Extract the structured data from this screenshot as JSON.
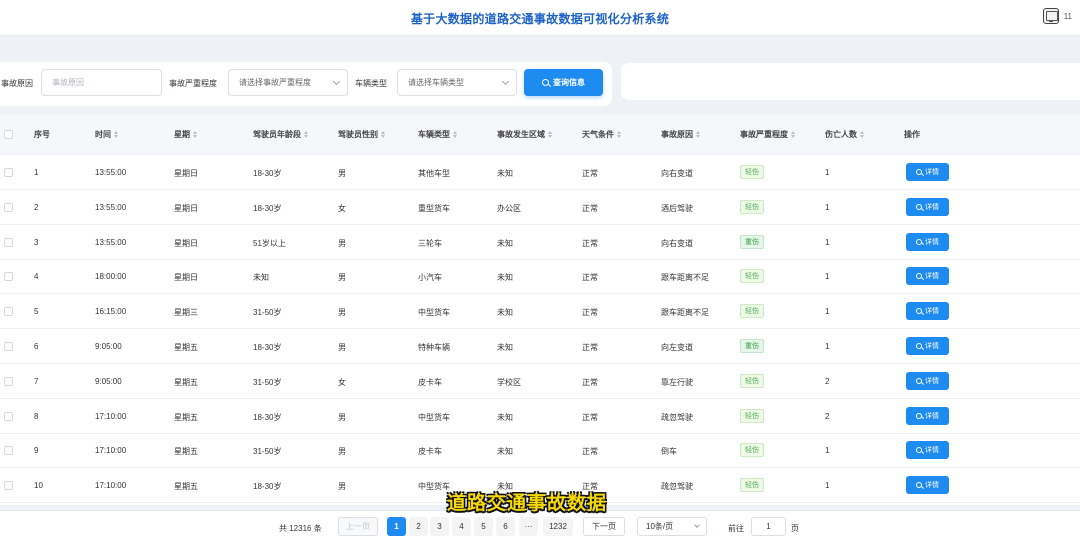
{
  "header": {
    "title": "基于大数据的道路交通事故数据可视化分析系统",
    "user": "11"
  },
  "filters": {
    "cause_label": "事故原因",
    "cause_placeholder": "事故原因",
    "severity_label": "事故严重程度",
    "severity_placeholder": "请选择事故严重程度",
    "vehicle_label": "车辆类型",
    "vehicle_placeholder": "请选择车辆类型",
    "search_label": "查询信息"
  },
  "table": {
    "headers": [
      "序号",
      "时间",
      "星期",
      "驾驶员年龄段",
      "驾驶员性别",
      "车辆类型",
      "事故发生区域",
      "天气条件",
      "事故原因",
      "事故严重程度",
      "伤亡人数",
      "操作"
    ],
    "detail_label": "详情",
    "rows": [
      [
        "1",
        "13:55:00",
        "星期日",
        "18-30岁",
        "男",
        "其他车型",
        "未知",
        "正常",
        "向右变道",
        "轻伤",
        "1"
      ],
      [
        "2",
        "13:55:00",
        "星期日",
        "18-30岁",
        "女",
        "重型货车",
        "办公区",
        "正常",
        "酒后驾驶",
        "轻伤",
        "1"
      ],
      [
        "3",
        "13:55:00",
        "星期日",
        "51岁以上",
        "男",
        "三轮车",
        "未知",
        "正常",
        "向右变道",
        "重伤",
        "1"
      ],
      [
        "4",
        "18:00:00",
        "星期日",
        "未知",
        "男",
        "小汽车",
        "未知",
        "正常",
        "跟车距离不足",
        "轻伤",
        "1"
      ],
      [
        "5",
        "16:15:00",
        "星期三",
        "31-50岁",
        "男",
        "中型货车",
        "未知",
        "正常",
        "跟车距离不足",
        "轻伤",
        "1"
      ],
      [
        "6",
        "9:05:00",
        "星期五",
        "18-30岁",
        "男",
        "特种车辆",
        "未知",
        "正常",
        "向左变道",
        "重伤",
        "1"
      ],
      [
        "7",
        "9:05:00",
        "星期五",
        "31-50岁",
        "女",
        "皮卡车",
        "学校区",
        "正常",
        "靠左行驶",
        "轻伤",
        "2"
      ],
      [
        "8",
        "17:10:00",
        "星期五",
        "18-30岁",
        "男",
        "中型货车",
        "未知",
        "正常",
        "疏忽驾驶",
        "轻伤",
        "2"
      ],
      [
        "9",
        "17:10:00",
        "星期五",
        "31-50岁",
        "男",
        "皮卡车",
        "未知",
        "正常",
        "倒车",
        "轻伤",
        "1"
      ],
      [
        "10",
        "17:10:00",
        "星期五",
        "18-30岁",
        "男",
        "中型货车",
        "未知",
        "正常",
        "疏忽驾驶",
        "轻伤",
        "1"
      ]
    ]
  },
  "pagination": {
    "total": "共 12316 条",
    "prev": "上一页",
    "next": "下一页",
    "pages": [
      "1",
      "2",
      "3",
      "4",
      "5",
      "6"
    ],
    "ellipsis": "···",
    "last": "1232",
    "page_size": "10条/页",
    "goto_label": "前往",
    "goto_value": "1",
    "page_suffix": "页"
  },
  "watermark": "道路交通事故数据"
}
